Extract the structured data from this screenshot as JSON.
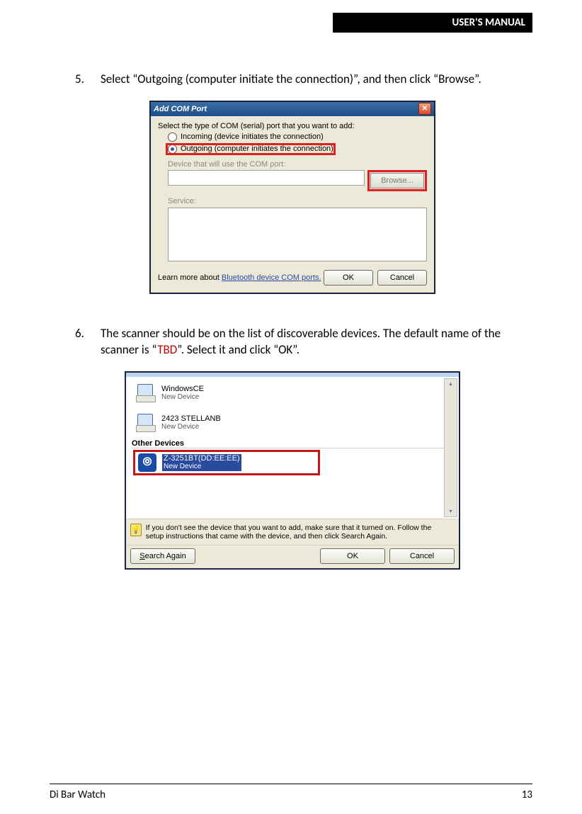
{
  "header": {
    "title": "USER'S MANUAL"
  },
  "steps": [
    {
      "num": "5.",
      "text": "Select “Outgoing (computer initiate the connection)”, and then click “Browse”."
    },
    {
      "num": "6.",
      "pre": "The scanner should be on the list of discoverable devices. The default name of the scanner is “",
      "red": "TBD",
      "post": "”. Select it and click “OK”."
    }
  ],
  "dlg1": {
    "title": "Add COM Port",
    "prompt": "Select the type of COM (serial) port that you want to add:",
    "opt_in": "Incoming (device initiates the connection)",
    "opt_out": "Outgoing (computer initiates the connection)",
    "device_lbl": "Device that will use the COM port:",
    "browse": "Browse...",
    "service_lbl": "Service:",
    "learn_pre": "Learn more about ",
    "learn_link": "Bluetooth device COM ports.",
    "ok": "OK",
    "cancel": "Cancel"
  },
  "dlg2": {
    "dev1_name": "WindowsCE",
    "dev1_sub": "New Device",
    "dev2_name": "2423 STELLANB",
    "dev2_sub": "New Device",
    "section": "Other Devices",
    "sel_name": "Z-3251BT(DD:EE:EE)",
    "sel_sub": "New Device",
    "info": "If you don't see the device that you want to add, make sure that it turned on. Follow the setup instructions that came with the device, and then click Search Again.",
    "search": "Search Again",
    "ok": "OK",
    "cancel": "Cancel"
  },
  "footer": {
    "left": "Di Bar Watch",
    "right": "13"
  }
}
